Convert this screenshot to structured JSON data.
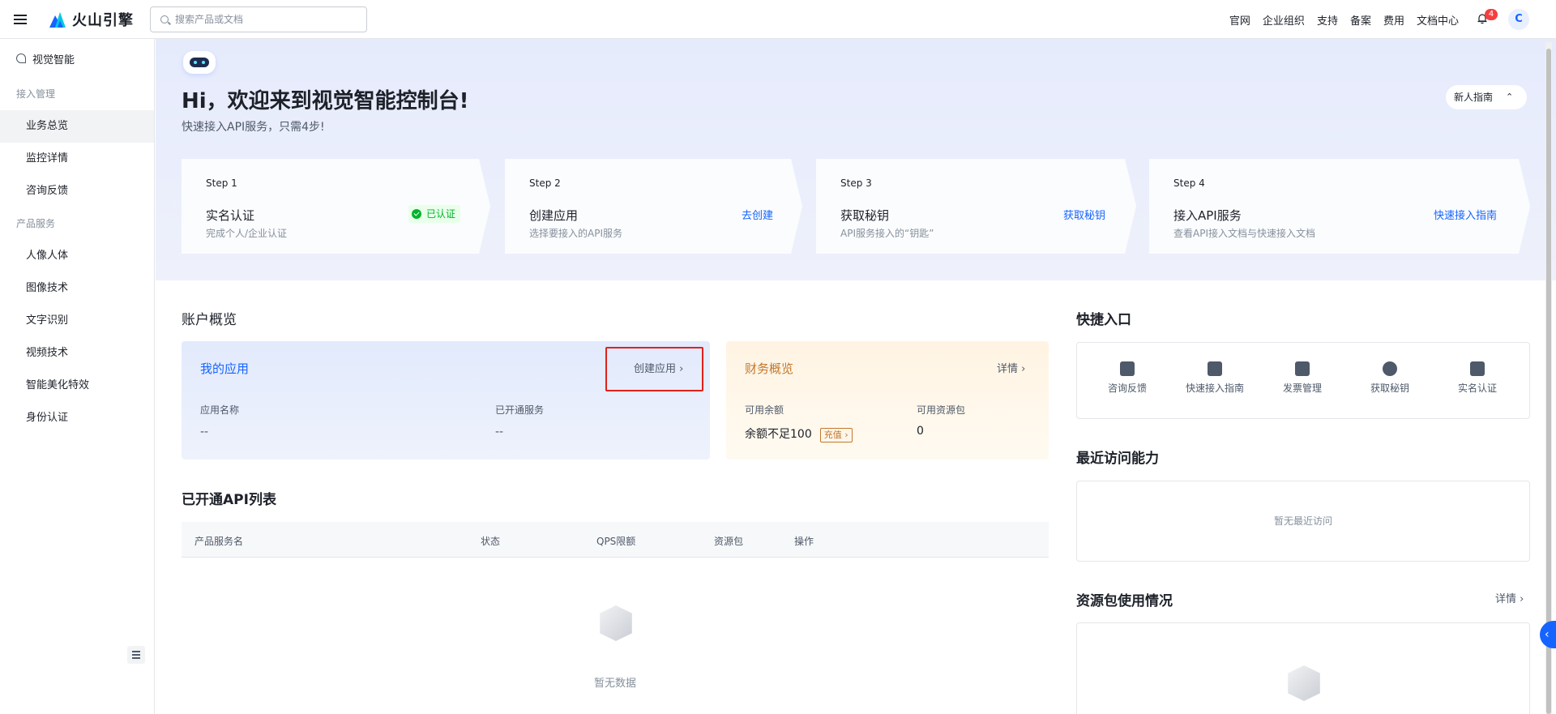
{
  "topbar": {
    "brand": "火山引擎",
    "search_placeholder": "搜索产品或文档",
    "links": [
      "官网",
      "企业组织",
      "支持",
      "备案",
      "费用",
      "文档中心"
    ],
    "notification_count": "4",
    "avatar_letter": "C"
  },
  "sidebar": {
    "header": "视觉智能",
    "groups": [
      {
        "label": "接入管理",
        "items": [
          "业务总览",
          "监控详情",
          "咨询反馈"
        ]
      },
      {
        "label": "产品服务",
        "items": [
          "人像人体",
          "图像技术",
          "文字识别",
          "视频技术",
          "智能美化特效",
          "身份认证"
        ]
      }
    ]
  },
  "hero": {
    "title": "Hi，欢迎来到视觉智能控制台!",
    "subtitle": "快速接入API服务，只需4步!",
    "guide_button": "新人指南"
  },
  "steps": [
    {
      "no": "Step 1",
      "title": "实名认证",
      "desc": "完成个人/企业认证",
      "action": "已认证"
    },
    {
      "no": "Step 2",
      "title": "创建应用",
      "desc": "选择要接入的API服务",
      "action": "去创建"
    },
    {
      "no": "Step 3",
      "title": "获取秘钥",
      "desc": "API服务接入的“钥匙”",
      "action": "获取秘钥"
    },
    {
      "no": "Step 4",
      "title": "接入API服务",
      "desc": "查看API接入文档与快速接入文档",
      "action": "快速接入指南"
    }
  ],
  "account": {
    "title": "账户概览",
    "my_app": {
      "title": "我的应用",
      "link": "创建应用",
      "app_name_label": "应用名称",
      "app_name_value": "--",
      "service_label": "已开通服务",
      "service_value": "--"
    },
    "finance": {
      "title": "财务概览",
      "link": "详情",
      "balance_label": "可用余额",
      "balance_value": "余额不足100",
      "recharge": "充值",
      "pack_label": "可用资源包",
      "pack_value": "0"
    }
  },
  "api_list": {
    "title": "已开通API列表",
    "columns": [
      "产品服务名",
      "状态",
      "QPS限额",
      "资源包",
      "操作"
    ],
    "empty": "暂无数据"
  },
  "quick": {
    "title": "快捷入口",
    "items": [
      "咨询反馈",
      "快速接入指南",
      "发票管理",
      "获取秘钥",
      "实名认证"
    ]
  },
  "recent": {
    "title": "最近访问能力",
    "empty": "暂无最近访问"
  },
  "resource": {
    "title": "资源包使用情况",
    "link": "详情"
  },
  "colors": {
    "accent": "#1664ff",
    "verified": "#00b42a",
    "highlight": "#e0211b"
  }
}
